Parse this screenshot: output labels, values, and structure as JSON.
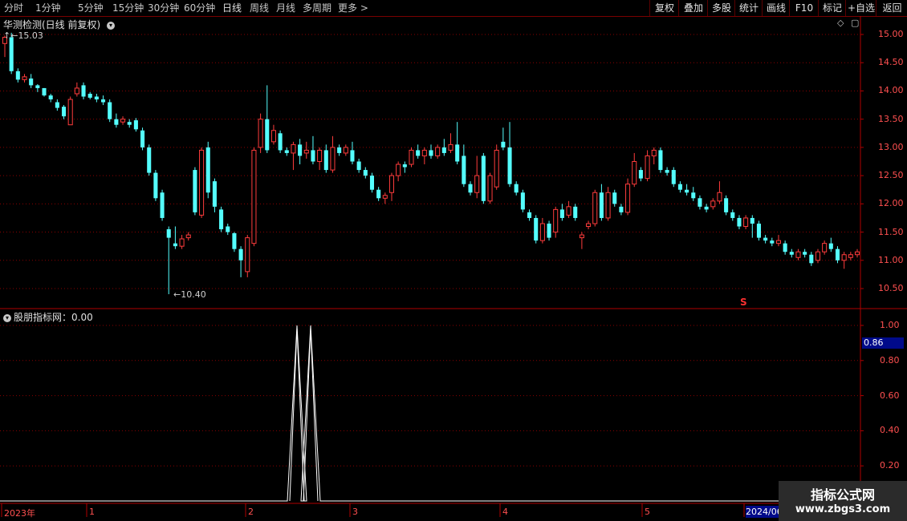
{
  "toolbar": {
    "periods": [
      "分时",
      "1分钟",
      "5分钟",
      "15分钟",
      "30分钟",
      "60分钟",
      "日线",
      "周线",
      "月线",
      "多周期",
      "更多 >"
    ],
    "active": "日线",
    "right": [
      "复权",
      "叠加",
      "多股",
      "统计",
      "画线",
      "F10",
      "+自选",
      "返回"
    ]
  },
  "main_chart": {
    "title": "华测检测(日线 前复权)",
    "high_label": "15.03",
    "low_label": "10.40",
    "y_ticks": [
      "15.00",
      "14.50",
      "14.00",
      "13.50",
      "13.00",
      "12.50",
      "12.00",
      "11.50",
      "11.00",
      "10.50"
    ],
    "signal_mark": "S"
  },
  "indicator": {
    "title": "股朋指标网：0.00",
    "y_ticks": [
      "1.00",
      "0.80",
      "0.60",
      "0.40",
      "0.20"
    ],
    "current_value": "0.86"
  },
  "dates": {
    "labels": [
      "2023年",
      "1",
      "2",
      "3",
      "4",
      "5"
    ],
    "current": "2024/06"
  },
  "watermark": {
    "line1": "指标公式网",
    "line2": "www.zbgs3.com"
  },
  "colors": {
    "up": "#ff3c3c",
    "down": "#54ffff",
    "grid": "#8a0000",
    "axis": "#b00000"
  },
  "chart_data": {
    "type": "candlestick",
    "ylim": [
      10.3,
      15.2
    ],
    "candles": [
      [
        14.84,
        14.95,
        14.6,
        14.98
      ],
      [
        14.95,
        14.35,
        14.3,
        15.03
      ],
      [
        14.35,
        14.2,
        14.15,
        14.4
      ],
      [
        14.2,
        14.25,
        14.15,
        14.3
      ],
      [
        14.22,
        14.1,
        14.05,
        14.3
      ],
      [
        14.1,
        14.05,
        13.98,
        14.12
      ],
      [
        14.05,
        13.92,
        13.9,
        14.05
      ],
      [
        13.92,
        13.85,
        13.8,
        13.95
      ],
      [
        13.8,
        13.7,
        13.65,
        13.85
      ],
      [
        13.72,
        13.55,
        13.5,
        13.75
      ],
      [
        13.4,
        13.85,
        13.4,
        13.9
      ],
      [
        13.95,
        14.05,
        13.9,
        14.15
      ],
      [
        14.1,
        13.9,
        13.85,
        14.15
      ],
      [
        13.95,
        13.88,
        13.85,
        13.98
      ],
      [
        13.9,
        13.85,
        13.8,
        13.95
      ],
      [
        13.85,
        13.8,
        13.75,
        13.92
      ],
      [
        13.8,
        13.5,
        13.45,
        13.85
      ],
      [
        13.5,
        13.4,
        13.35,
        13.6
      ],
      [
        13.45,
        13.5,
        13.4,
        13.55
      ],
      [
        13.45,
        13.4,
        13.35,
        13.5
      ],
      [
        13.48,
        13.32,
        13.28,
        13.52
      ],
      [
        13.3,
        13.0,
        12.95,
        13.35
      ],
      [
        13.0,
        12.55,
        12.5,
        13.05
      ],
      [
        12.55,
        12.1,
        12.05,
        12.6
      ],
      [
        12.2,
        11.75,
        11.7,
        12.25
      ],
      [
        11.55,
        11.4,
        10.4,
        11.6
      ],
      [
        11.3,
        11.25,
        11.2,
        11.6
      ],
      [
        11.25,
        11.38,
        11.2,
        11.45
      ],
      [
        11.4,
        11.45,
        11.35,
        11.5
      ],
      [
        12.6,
        11.85,
        11.8,
        12.65
      ],
      [
        11.8,
        12.95,
        11.75,
        13.0
      ],
      [
        13.0,
        12.2,
        12.1,
        13.1
      ],
      [
        12.4,
        11.95,
        11.85,
        12.45
      ],
      [
        11.9,
        11.55,
        11.5,
        11.95
      ],
      [
        11.6,
        11.5,
        11.45,
        11.65
      ],
      [
        11.48,
        11.2,
        11.15,
        11.5
      ],
      [
        11.2,
        11.0,
        10.7,
        11.25
      ],
      [
        10.8,
        11.4,
        10.7,
        11.45
      ],
      [
        11.3,
        12.95,
        11.25,
        13.0
      ],
      [
        13.0,
        13.5,
        12.9,
        13.6
      ],
      [
        13.5,
        12.95,
        12.9,
        14.1
      ],
      [
        13.1,
        13.3,
        13.05,
        13.4
      ],
      [
        13.25,
        12.95,
        12.9,
        13.3
      ],
      [
        12.95,
        12.9,
        12.85,
        13.0
      ],
      [
        12.9,
        13.05,
        12.6,
        13.1
      ],
      [
        13.05,
        12.85,
        12.7,
        13.15
      ],
      [
        12.9,
        12.95,
        12.8,
        13.1
      ],
      [
        12.95,
        12.75,
        12.7,
        13.2
      ],
      [
        12.75,
        12.95,
        12.6,
        13.0
      ],
      [
        12.95,
        12.6,
        12.55,
        13.05
      ],
      [
        12.6,
        13.0,
        12.55,
        13.2
      ],
      [
        13.0,
        12.9,
        12.85,
        13.05
      ],
      [
        12.9,
        13.0,
        12.85,
        13.05
      ],
      [
        12.95,
        12.75,
        12.7,
        13.1
      ],
      [
        12.75,
        12.6,
        12.55,
        12.8
      ],
      [
        12.6,
        12.5,
        12.45,
        12.65
      ],
      [
        12.5,
        12.25,
        12.2,
        12.55
      ],
      [
        12.25,
        12.1,
        12.05,
        12.3
      ],
      [
        12.1,
        12.15,
        12.0,
        12.2
      ],
      [
        12.2,
        12.5,
        12.05,
        12.55
      ],
      [
        12.5,
        12.7,
        12.4,
        12.75
      ],
      [
        12.7,
        12.65,
        12.55,
        12.75
      ],
      [
        12.7,
        12.95,
        12.65,
        13.0
      ],
      [
        12.95,
        12.85,
        12.8,
        13.05
      ],
      [
        12.85,
        12.95,
        12.7,
        13.0
      ],
      [
        12.95,
        12.85,
        12.8,
        13.05
      ],
      [
        12.85,
        13.0,
        12.8,
        13.05
      ],
      [
        13.0,
        12.9,
        12.85,
        13.15
      ],
      [
        12.95,
        13.05,
        12.9,
        13.25
      ],
      [
        13.05,
        12.75,
        12.7,
        13.45
      ],
      [
        12.85,
        12.35,
        12.3,
        13.05
      ],
      [
        12.35,
        12.2,
        12.15,
        12.4
      ],
      [
        12.2,
        12.5,
        12.1,
        12.85
      ],
      [
        12.85,
        12.05,
        12.0,
        12.9
      ],
      [
        12.05,
        12.5,
        12.0,
        12.55
      ],
      [
        12.3,
        12.95,
        12.25,
        13.05
      ],
      [
        13.1,
        13.0,
        12.95,
        13.35
      ],
      [
        13.0,
        12.35,
        12.3,
        13.45
      ],
      [
        12.35,
        12.2,
        12.15,
        12.4
      ],
      [
        12.2,
        11.9,
        11.85,
        12.25
      ],
      [
        11.85,
        11.75,
        11.7,
        11.9
      ],
      [
        11.75,
        11.35,
        11.3,
        11.8
      ],
      [
        11.35,
        11.65,
        11.3,
        11.75
      ],
      [
        11.65,
        11.4,
        11.35,
        11.7
      ],
      [
        11.5,
        11.9,
        11.4,
        11.95
      ],
      [
        11.9,
        11.75,
        11.7,
        12.0
      ],
      [
        11.8,
        11.95,
        11.75,
        12.05
      ],
      [
        11.95,
        11.75,
        11.7,
        12.0
      ],
      [
        11.4,
        11.45,
        11.2,
        11.5
      ],
      [
        11.6,
        11.65,
        11.55,
        11.7
      ],
      [
        11.65,
        12.2,
        11.6,
        12.25
      ],
      [
        12.2,
        11.75,
        11.7,
        12.35
      ],
      [
        11.75,
        12.2,
        11.7,
        12.3
      ],
      [
        12.2,
        12.0,
        11.95,
        12.25
      ],
      [
        11.95,
        11.85,
        11.8,
        12.0
      ],
      [
        11.85,
        12.35,
        11.8,
        12.45
      ],
      [
        12.35,
        12.75,
        12.3,
        12.9
      ],
      [
        12.6,
        12.45,
        12.4,
        12.65
      ],
      [
        12.45,
        12.85,
        12.4,
        12.95
      ],
      [
        12.85,
        12.95,
        12.7,
        13.0
      ],
      [
        12.95,
        12.6,
        12.55,
        13.0
      ],
      [
        12.6,
        12.55,
        12.5,
        12.65
      ],
      [
        12.6,
        12.35,
        12.3,
        12.65
      ],
      [
        12.35,
        12.25,
        12.2,
        12.4
      ],
      [
        12.25,
        12.2,
        12.15,
        12.35
      ],
      [
        12.2,
        12.1,
        12.05,
        12.3
      ],
      [
        12.1,
        11.95,
        11.9,
        12.15
      ],
      [
        11.95,
        11.9,
        11.85,
        12.0
      ],
      [
        11.95,
        12.05,
        11.9,
        12.1
      ],
      [
        12.05,
        12.2,
        12.0,
        12.4
      ],
      [
        12.1,
        11.85,
        11.8,
        12.15
      ],
      [
        11.85,
        11.75,
        11.7,
        11.9
      ],
      [
        11.75,
        11.6,
        11.55,
        11.8
      ],
      [
        11.6,
        11.75,
        11.55,
        11.8
      ],
      [
        11.75,
        11.65,
        11.4,
        11.8
      ],
      [
        11.65,
        11.4,
        11.35,
        11.7
      ],
      [
        11.4,
        11.35,
        11.3,
        11.45
      ],
      [
        11.35,
        11.3,
        11.25,
        11.4
      ],
      [
        11.3,
        11.35,
        11.25,
        11.45
      ],
      [
        11.3,
        11.15,
        11.1,
        11.35
      ],
      [
        11.15,
        11.1,
        11.05,
        11.2
      ],
      [
        11.05,
        11.15,
        11.0,
        11.2
      ],
      [
        11.15,
        11.1,
        11.05,
        11.2
      ],
      [
        11.1,
        10.95,
        10.9,
        11.15
      ],
      [
        11.0,
        11.15,
        10.95,
        11.2
      ],
      [
        11.15,
        11.3,
        11.1,
        11.35
      ],
      [
        11.3,
        11.2,
        11.15,
        11.4
      ],
      [
        11.2,
        11.0,
        10.95,
        11.25
      ],
      [
        11.0,
        11.1,
        10.85,
        11.15
      ],
      [
        11.05,
        11.1,
        11.0,
        11.15
      ],
      [
        11.1,
        11.15,
        11.05,
        11.2
      ]
    ],
    "indicator_spikes": [
      [
        370,
        1.0
      ],
      [
        387,
        1.0
      ]
    ]
  }
}
